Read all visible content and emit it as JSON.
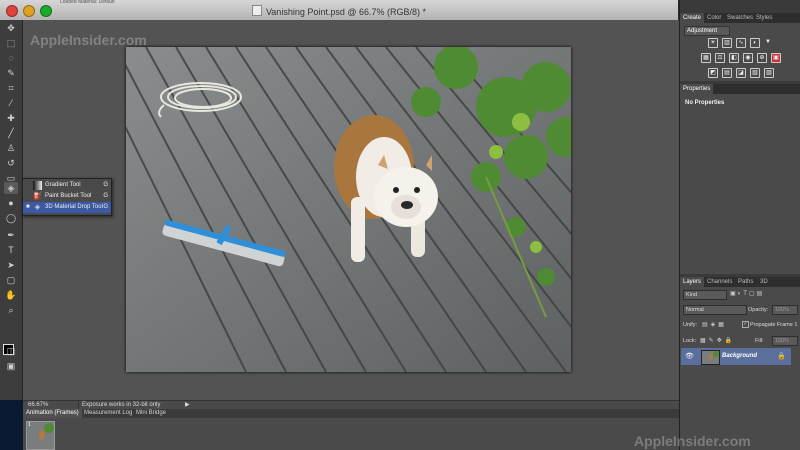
{
  "window": {
    "title": "Vanishing Point.psd @ 66.7% (RGB/8) *",
    "loaded_strip": "Loaded Material: Default"
  },
  "tool_flyout": {
    "items": [
      {
        "label": "Gradient Tool",
        "key": "G",
        "selected": false
      },
      {
        "label": "Paint Bucket Tool",
        "key": "G",
        "selected": false
      },
      {
        "label": "3D Material Drop Tool",
        "key": "G",
        "selected": true
      }
    ]
  },
  "status_bar": {
    "zoom": "66.67%",
    "info": "Exposure works in 32-bit only"
  },
  "bottom_panel": {
    "tabs": [
      "Animation (Frames)",
      "Measurement Log",
      "Mini Bridge"
    ],
    "frame_number": "1"
  },
  "right_panels": {
    "top_tabs": [
      "Create",
      "Color",
      "Swatches",
      "Styles"
    ],
    "adjustment_select": "Adjustment",
    "properties_tab": "Properties",
    "properties_empty": "No Properties",
    "layers_tabs": [
      "Layers",
      "Channels",
      "Paths",
      "3D"
    ],
    "kind_filter": "Kind",
    "blend_mode": "Normal",
    "opacity_label": "Opacity:",
    "opacity_value": "100%",
    "unify_label": "Unify:",
    "propagate_label": "Propagate Frame 1",
    "lock_label": "Lock:",
    "fill_label": "Fill:",
    "fill_value": "100%",
    "layer_name": "Background"
  },
  "watermarks": {
    "top": "AppleInsider.com",
    "bottom": "AppleInsider.com"
  },
  "icons": {
    "tools": [
      "move-icon",
      "marquee-icon",
      "lasso-icon",
      "quick-select-icon",
      "crop-icon",
      "eyedropper-icon",
      "healing-icon",
      "brush-icon",
      "stamp-icon",
      "history-brush-icon",
      "eraser-icon",
      "material-drop-icon",
      "blur-icon",
      "dodge-icon",
      "pen-icon",
      "type-icon",
      "path-select-icon",
      "shape-icon",
      "hand-icon",
      "zoom-icon"
    ]
  },
  "colors": {
    "selection": "#3b5aa3",
    "layer_selected": "#5b6f9c",
    "panel": "#4a4a4a",
    "workspace": "#535353"
  }
}
